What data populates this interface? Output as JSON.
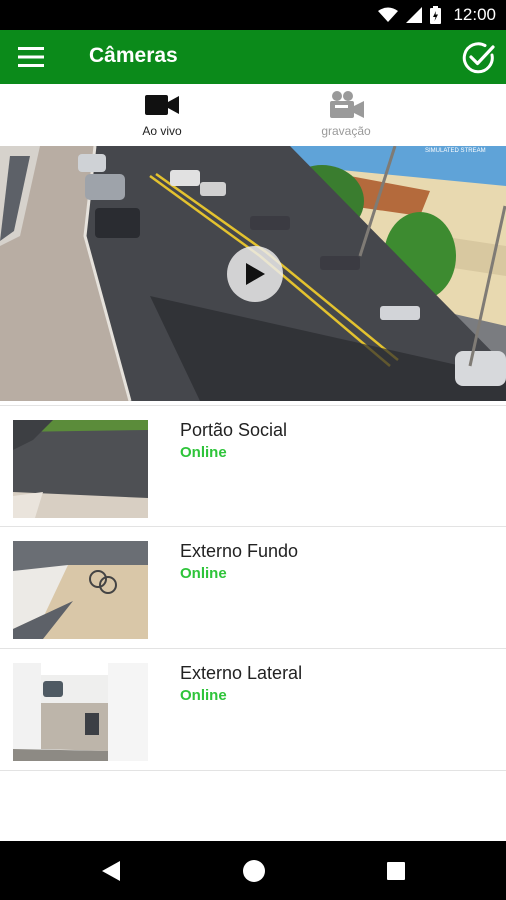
{
  "status_bar": {
    "time": "12:00"
  },
  "app_bar": {
    "title": "Câmeras"
  },
  "tabs": [
    {
      "label": "Ao vivo",
      "icon": "videocam-icon",
      "active": true
    },
    {
      "label": "gravação",
      "icon": "recording-camera-icon",
      "active": false
    }
  ],
  "player": {
    "overlay_text": "SIMULATED STREAM",
    "play_icon": "play-icon"
  },
  "cameras": [
    {
      "name": "Portão Social",
      "status": "Online"
    },
    {
      "name": "Externo Fundo",
      "status": "Online"
    },
    {
      "name": "Externo Lateral",
      "status": "Online"
    }
  ],
  "colors": {
    "app_bar": "#0b8a1a",
    "status_online": "#2ec43a",
    "tab_inactive": "#9a9a9a"
  }
}
